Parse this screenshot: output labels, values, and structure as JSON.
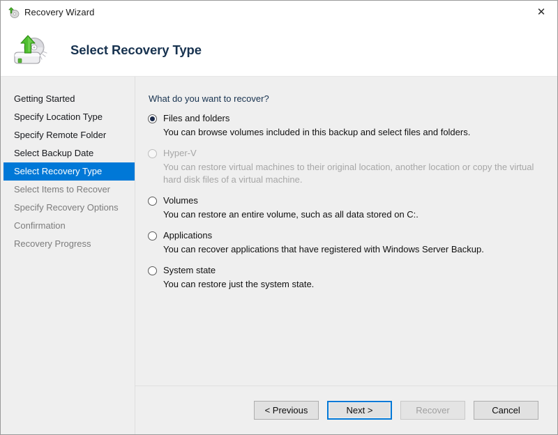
{
  "window": {
    "title": "Recovery Wizard",
    "title_icon": "recovery-wizard-icon",
    "close_icon": "close-icon"
  },
  "header": {
    "icon": "disk-restore-icon",
    "title": "Select Recovery Type"
  },
  "sidebar": {
    "items": [
      {
        "label": "Getting Started",
        "state": "completed"
      },
      {
        "label": "Specify Location Type",
        "state": "completed"
      },
      {
        "label": "Specify Remote Folder",
        "state": "completed"
      },
      {
        "label": "Select Backup Date",
        "state": "completed"
      },
      {
        "label": "Select Recovery Type",
        "state": "active"
      },
      {
        "label": "Select Items to Recover",
        "state": "upcoming"
      },
      {
        "label": "Specify Recovery Options",
        "state": "upcoming"
      },
      {
        "label": "Confirmation",
        "state": "upcoming"
      },
      {
        "label": "Recovery Progress",
        "state": "upcoming"
      }
    ],
    "active_index": 4
  },
  "main": {
    "question": "What do you want to recover?",
    "options": [
      {
        "label": "Files and folders",
        "description": "You can browse volumes included in this backup and select files and folders.",
        "selected": true,
        "disabled": false
      },
      {
        "label": "Hyper-V",
        "description": "You can restore virtual machines to their original location, another location or copy the virtual hard disk files of a virtual machine.",
        "selected": false,
        "disabled": true
      },
      {
        "label": "Volumes",
        "description": "You can restore an entire volume, such as all data stored on C:.",
        "selected": false,
        "disabled": false
      },
      {
        "label": "Applications",
        "description": "You can recover applications that have registered with Windows Server Backup.",
        "selected": false,
        "disabled": false
      },
      {
        "label": "System state",
        "description": "You can restore just the system state.",
        "selected": false,
        "disabled": false
      }
    ]
  },
  "footer": {
    "buttons": [
      {
        "label": "< Previous",
        "state": "normal"
      },
      {
        "label": "Next >",
        "state": "focused"
      },
      {
        "label": "Recover",
        "state": "disabled"
      },
      {
        "label": "Cancel",
        "state": "normal"
      }
    ]
  },
  "colors": {
    "accent": "#0078d7",
    "sidebar_bg": "#efefef",
    "content_bg": "#efefef",
    "header_title": "#17324f",
    "disabled_text": "#a6a6a6"
  }
}
